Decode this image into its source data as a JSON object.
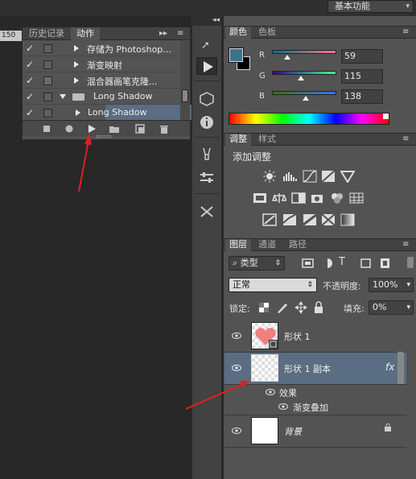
{
  "workspace": {
    "label": "基本功能"
  },
  "ruler": {
    "tick": "150"
  },
  "actions_panel": {
    "tabs": [
      "历史记录",
      "动作"
    ],
    "active_tab": "动作",
    "rows": [
      {
        "label": "存储为 Photoshop...",
        "checked": true
      },
      {
        "label": "渐变映射",
        "checked": true
      },
      {
        "label": "混合器画笔克隆...",
        "checked": true
      },
      {
        "label": "Long Shadow",
        "checked": true,
        "kind": "set"
      },
      {
        "label": "Long Shadow",
        "checked": true,
        "kind": "action",
        "selected": true
      }
    ],
    "bottom_buttons": [
      "stop-icon",
      "record-icon",
      "play-icon",
      "new-set-icon",
      "new-action-icon",
      "trash-icon"
    ]
  },
  "color_panel": {
    "tabs": [
      "颜色",
      "色板"
    ],
    "active_tab": "颜色",
    "foreground": "#3b738a",
    "background": "#000000",
    "channels": [
      {
        "label": "R",
        "value": "59"
      },
      {
        "label": "G",
        "value": "115"
      },
      {
        "label": "B",
        "value": "138"
      }
    ]
  },
  "adjust_panel": {
    "tabs": [
      "调整",
      "样式"
    ],
    "active_tab": "调整",
    "title": "添加调整"
  },
  "layers_panel": {
    "tabs": [
      "图层",
      "通道",
      "路径"
    ],
    "active_tab": "图层",
    "filter_label": "类型",
    "blend_mode": "正常",
    "opacity_label": "不透明度:",
    "opacity_value": "100%",
    "lock_label": "锁定:",
    "fill_label": "填充:",
    "fill_value": "0%",
    "layers": [
      {
        "name": "形状 1",
        "selected": false
      },
      {
        "name": "形状 1 副本",
        "selected": true,
        "fx": "fx"
      },
      {
        "name": "背景",
        "selected": false
      }
    ],
    "effects_label": "效果",
    "effect_item": "渐变叠加"
  },
  "colors": {
    "annotation_arrow": "#e02020",
    "selection": "#5a6d82",
    "shape_fill": "#f08080"
  }
}
